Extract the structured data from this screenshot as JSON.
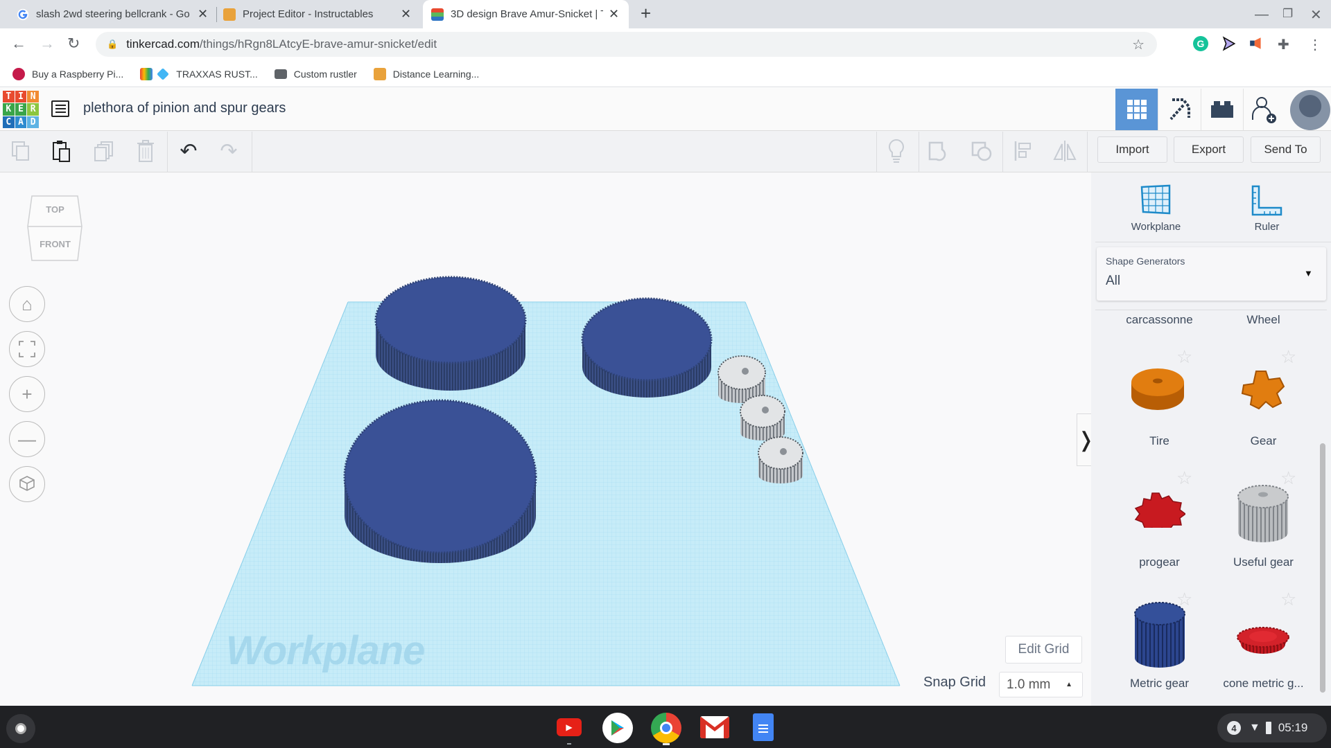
{
  "browser": {
    "tabs": [
      {
        "title": "slash 2wd steering bellcrank - Go",
        "icon": "google-icon",
        "active": false
      },
      {
        "title": "Project Editor - Instructables",
        "icon": "instructables-robot-icon",
        "active": false
      },
      {
        "title": "3D design Brave Amur-Snicket | T",
        "icon": "tinkercad-icon",
        "active": true
      }
    ],
    "new_tab_label": "+",
    "url_domain": "tinkercad.com",
    "url_path": "/things/hRgn8LAtcyE-brave-amur-snicket/edit",
    "bookmarks": [
      {
        "label": "Buy a Raspberry Pi...",
        "icon": "raspberry-icon"
      },
      {
        "label": "TRAXXAS RUST...",
        "icon": "diamond-icon"
      },
      {
        "label": "Custom rustler",
        "icon": "folder-icon"
      },
      {
        "label": "Distance Learning...",
        "icon": "instructables-robot-icon"
      }
    ],
    "extensions": [
      "grammarly-icon",
      "cursor-icon",
      "megaphone-icon",
      "puzzle-icon",
      "more-icon"
    ]
  },
  "tinkercad": {
    "logo_letters": [
      "T",
      "I",
      "N",
      "K",
      "E",
      "R",
      "C",
      "A",
      "D"
    ],
    "design_title": "plethora of pinion and spur gears",
    "header_buttons": [
      "3d-view",
      "blocks",
      "bricks",
      "invite",
      "profile"
    ],
    "toolbar": {
      "import_label": "Import",
      "export_label": "Export",
      "sendto_label": "Send To"
    },
    "viewcube": {
      "top": "TOP",
      "front": "FRONT"
    },
    "workplane_label": "Workplane",
    "edit_grid_label": "Edit Grid",
    "snap_grid_label": "Snap Grid",
    "snap_grid_value": "1.0 mm",
    "panel": {
      "workplane_label": "Workplane",
      "ruler_label": "Ruler",
      "category_caption": "Shape Generators",
      "category_value": "All",
      "partial_row": [
        "carcassonne",
        "Wheel"
      ],
      "shapes": [
        {
          "label": "Tire",
          "color": "#d8780f"
        },
        {
          "label": "Gear",
          "color": "#d8780f"
        },
        {
          "label": "progear",
          "color": "#c81a20"
        },
        {
          "label": "Useful gear",
          "color": "#a9abad"
        },
        {
          "label": "Metric gear",
          "color": "#263f85"
        },
        {
          "label": "cone metric g...",
          "color": "#c81a20"
        }
      ]
    },
    "colors": {
      "accent": "#5a95d6",
      "gear_blue": "#3a5196",
      "grid": "#8fd3ee"
    }
  },
  "taskbar": {
    "apps": [
      "youtube-icon",
      "play-store-icon",
      "chrome-icon",
      "gmail-icon",
      "docs-icon"
    ],
    "notification_count": "4",
    "time": "05:19"
  }
}
